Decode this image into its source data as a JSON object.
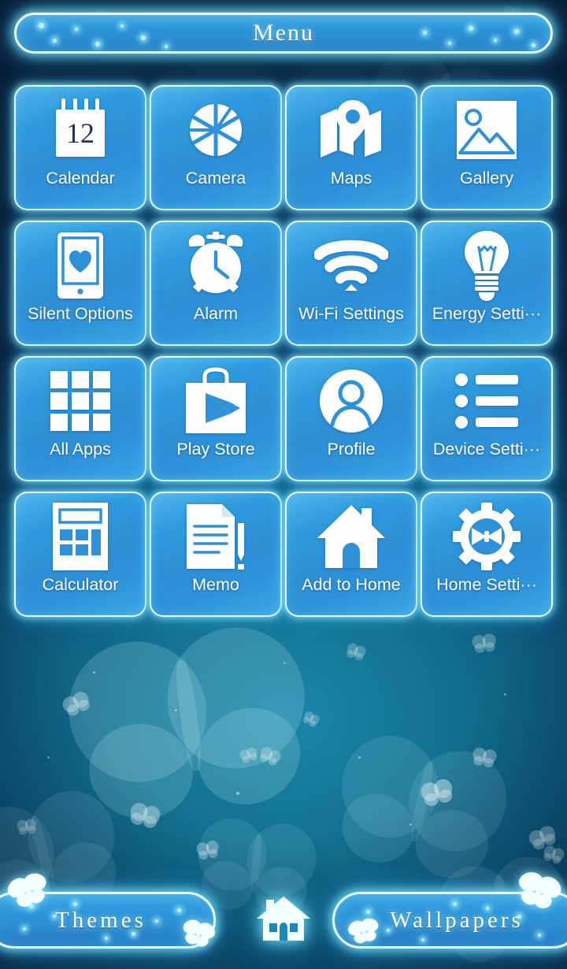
{
  "header": {
    "title": "Menu"
  },
  "apps": [
    {
      "label": "Calendar",
      "icon": "calendar-icon",
      "badge": "12"
    },
    {
      "label": "Camera",
      "icon": "camera-shutter-icon"
    },
    {
      "label": "Maps",
      "icon": "map-pin-icon"
    },
    {
      "label": "Gallery",
      "icon": "photo-picture-icon"
    },
    {
      "label": "Silent Options",
      "icon": "phone-heart-icon"
    },
    {
      "label": "Alarm",
      "icon": "alarm-clock-icon"
    },
    {
      "label": "Wi-Fi Settings",
      "icon": "wifi-icon"
    },
    {
      "label": "Energy Setti···",
      "icon": "lightbulb-icon"
    },
    {
      "label": "All Apps",
      "icon": "grid-apps-icon"
    },
    {
      "label": "Play Store",
      "icon": "play-store-bag-icon"
    },
    {
      "label": "Profile",
      "icon": "person-circle-icon"
    },
    {
      "label": "Device Setti···",
      "icon": "bulleted-list-icon"
    },
    {
      "label": "Calculator",
      "icon": "calculator-icon"
    },
    {
      "label": "Memo",
      "icon": "note-pencil-icon"
    },
    {
      "label": "Add to Home",
      "icon": "house-icon"
    },
    {
      "label": "Home Setti···",
      "icon": "gear-butterfly-icon"
    }
  ],
  "dock": {
    "themes_label": "Themes",
    "wallpapers_label": "Wallpapers",
    "home_icon": "home-icon"
  },
  "colors": {
    "tile_light": "#4fb4ea",
    "tile_dark": "#1f7cc4",
    "tile_border": "#e8feff",
    "glow": "#7ce6ff",
    "bg_top": "#0a2340",
    "bg_mid": "#106f90",
    "label_text": "#ffffff",
    "calendar_number": "#1d3557"
  }
}
